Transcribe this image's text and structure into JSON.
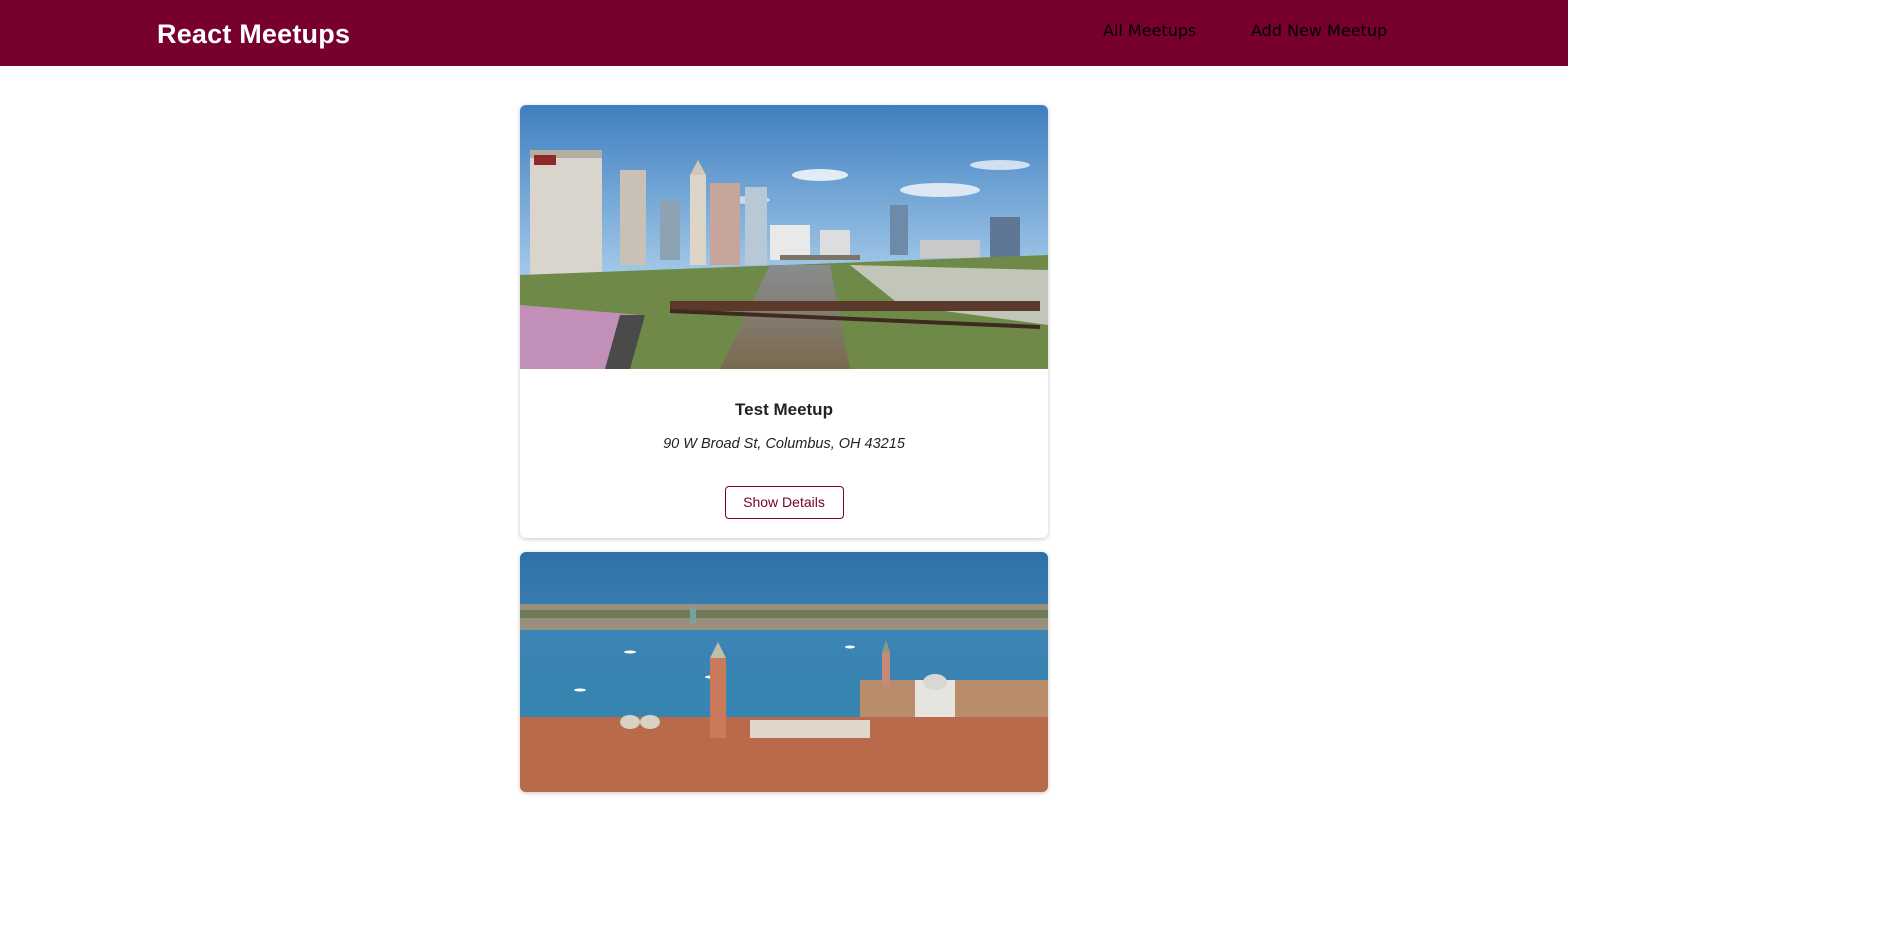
{
  "header": {
    "logo": "React Meetups",
    "nav": {
      "all_meetups": "All Meetups",
      "add_new_meetup": "Add New Meetup"
    }
  },
  "colors": {
    "brand": "#77002e",
    "nav_link": "#fcb8d2"
  },
  "meetups": [
    {
      "title": "Test Meetup",
      "address": "90 W Broad St, Columbus, OH 43215",
      "button_label": "Show Details",
      "image_alt": "columbus-skyline-photo"
    },
    {
      "image_alt": "venice-aerial-photo"
    }
  ]
}
